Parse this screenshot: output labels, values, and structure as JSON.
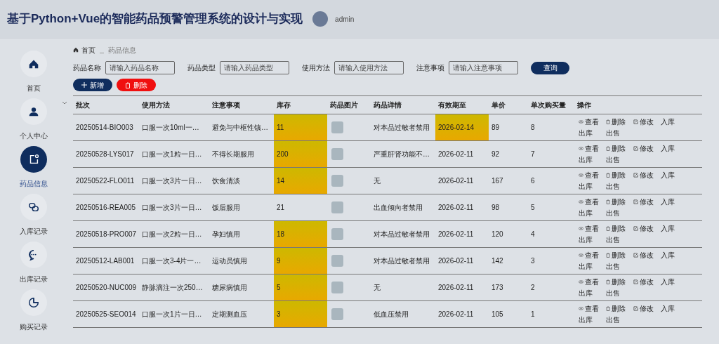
{
  "header": {
    "title": "基于Python+Vue的智能药品预警管理系统的设计与实现",
    "username": "admin"
  },
  "sidebar": {
    "items": [
      {
        "kind": "home",
        "label": "首页",
        "selected": false
      },
      {
        "kind": "user",
        "label": "个人中心",
        "selected": false
      },
      {
        "kind": "note",
        "label": "药品信息",
        "selected": true
      },
      {
        "kind": "link",
        "label": "入库记录",
        "selected": false
      },
      {
        "kind": "chat",
        "label": "出库记录",
        "selected": false
      },
      {
        "kind": "pie",
        "label": "购买记录",
        "selected": false
      }
    ]
  },
  "breadcrumb": [
    "首页",
    "药品信息"
  ],
  "filters": [
    {
      "label": "药品名称",
      "placeholder": "请输入药品名称"
    },
    {
      "label": "药品类型",
      "placeholder": "请输入药品类型"
    },
    {
      "label": "使用方法",
      "placeholder": "请输入使用方法"
    },
    {
      "label": "注意事项",
      "placeholder": "请输入注意事项"
    }
  ],
  "search_button": "查询",
  "add_button": "新增",
  "delete_button": "删除",
  "table": {
    "columns": [
      "批次",
      "使用方法",
      "注意事项",
      "库存",
      "药品图片",
      "药品详情",
      "有效期至",
      "单价",
      "单次购买量",
      "操作"
    ],
    "rows": [
      {
        "batch": "20250514-BIO003",
        "usage": "口服一次10ml一…",
        "notes": "避免与中枢性镇…",
        "stock": "11",
        "stock_warning": true,
        "details": "对本品过敏者禁用",
        "expiry": "2026-02-14",
        "expiry_warning": true,
        "price": "89",
        "qty": "8",
        "actions": [
          "查看",
          "删除",
          "修改",
          "入库",
          "出库",
          "出售"
        ]
      },
      {
        "batch": "20250528-LYS017",
        "usage": "口服一次1粒一日…",
        "notes": "不得长期服用",
        "stock": "200",
        "stock_warning": true,
        "details": "严重肝肾功能不…",
        "expiry": "2026-02-11",
        "expiry_warning": false,
        "price": "92",
        "qty": "7",
        "actions": [
          "查看",
          "删除",
          "修改",
          "入库",
          "出库",
          "出售"
        ]
      },
      {
        "batch": "20250522-FLO011",
        "usage": "口服一次3片一日…",
        "notes": "饮食清淡",
        "stock": "14",
        "stock_warning": true,
        "details": "无",
        "expiry": "2026-02-11",
        "expiry_warning": false,
        "price": "167",
        "qty": "6",
        "actions": [
          "查看",
          "删除",
          "修改",
          "入库",
          "出库",
          "出售"
        ]
      },
      {
        "batch": "20250516-REA005",
        "usage": "口服一次3片一日…",
        "notes": "饭后服用",
        "stock": "21",
        "stock_warning": false,
        "details": "出血倾向者禁用",
        "expiry": "2026-02-11",
        "expiry_warning": false,
        "price": "98",
        "qty": "5",
        "actions": [
          "查看",
          "删除",
          "修改",
          "入库",
          "出库",
          "出售"
        ]
      },
      {
        "batch": "20250518-PRO007",
        "usage": "口服一次2粒一日…",
        "notes": "孕妇慎用",
        "stock": "18",
        "stock_warning": true,
        "details": "对本品过敏者禁用",
        "expiry": "2026-02-11",
        "expiry_warning": false,
        "price": "120",
        "qty": "4",
        "actions": [
          "查看",
          "删除",
          "修改",
          "入库",
          "出库",
          "出售"
        ]
      },
      {
        "batch": "20250512-LAB001",
        "usage": "口服一次3-4片一…",
        "notes": "运动员慎用",
        "stock": "9",
        "stock_warning": true,
        "details": "对本品过敏者禁用",
        "expiry": "2026-02-11",
        "expiry_warning": false,
        "price": "142",
        "qty": "3",
        "actions": [
          "查看",
          "删除",
          "修改",
          "入库",
          "出库",
          "出售"
        ]
      },
      {
        "batch": "20250520-NUC009",
        "usage": "静脉滴注一次250…",
        "notes": "糖尿病慎用",
        "stock": "5",
        "stock_warning": true,
        "details": "无",
        "expiry": "2026-02-11",
        "expiry_warning": false,
        "price": "173",
        "qty": "2",
        "actions": [
          "查看",
          "删除",
          "修改",
          "入库",
          "出库",
          "出售"
        ]
      },
      {
        "batch": "20250525-SEO014",
        "usage": "口服一次1片一日…",
        "notes": "定期测血压",
        "stock": "3",
        "stock_warning": true,
        "details": "低血压禁用",
        "expiry": "2026-02-11",
        "expiry_warning": false,
        "price": "105",
        "qty": "1",
        "actions": [
          "查看",
          "删除",
          "修改",
          "入库",
          "出库",
          "出售"
        ]
      }
    ]
  }
}
